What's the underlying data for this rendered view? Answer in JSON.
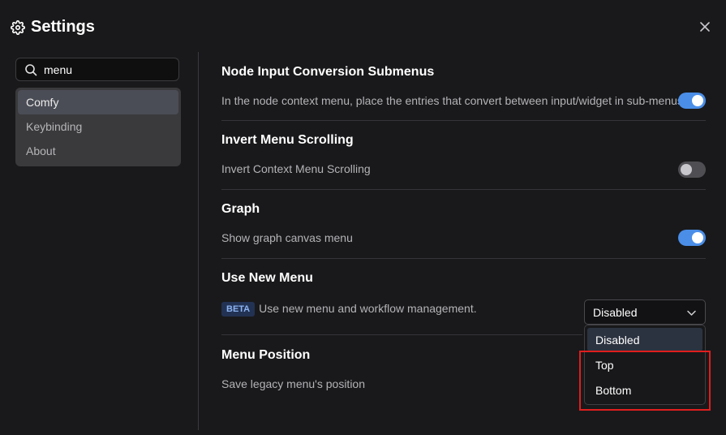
{
  "header": {
    "title": "Settings",
    "icon": "gear-icon"
  },
  "search": {
    "value": "menu"
  },
  "sidebar": {
    "items": [
      {
        "label": "Comfy",
        "active": true
      },
      {
        "label": "Keybinding"
      },
      {
        "label": "About"
      }
    ]
  },
  "settings": [
    {
      "title": "Node Input Conversion Submenus",
      "description": "In the node context menu, place the entries that convert between input/widget in sub-menus.",
      "enabled": true
    },
    {
      "title": "Invert Menu Scrolling",
      "description": "Invert Context Menu Scrolling",
      "enabled": false
    },
    {
      "title": "Graph",
      "description": "Show graph canvas menu",
      "enabled": true
    },
    {
      "title": "Use New Menu",
      "badge": "BETA",
      "description": "Use new menu and workflow management.",
      "value": "Disabled",
      "options": [
        "Disabled",
        "Top",
        "Bottom"
      ]
    },
    {
      "title": "Menu Position",
      "description": "Save legacy menu's position"
    }
  ],
  "colors": {
    "accent": "#4a8ee8",
    "highlight": "#e01e1e"
  }
}
